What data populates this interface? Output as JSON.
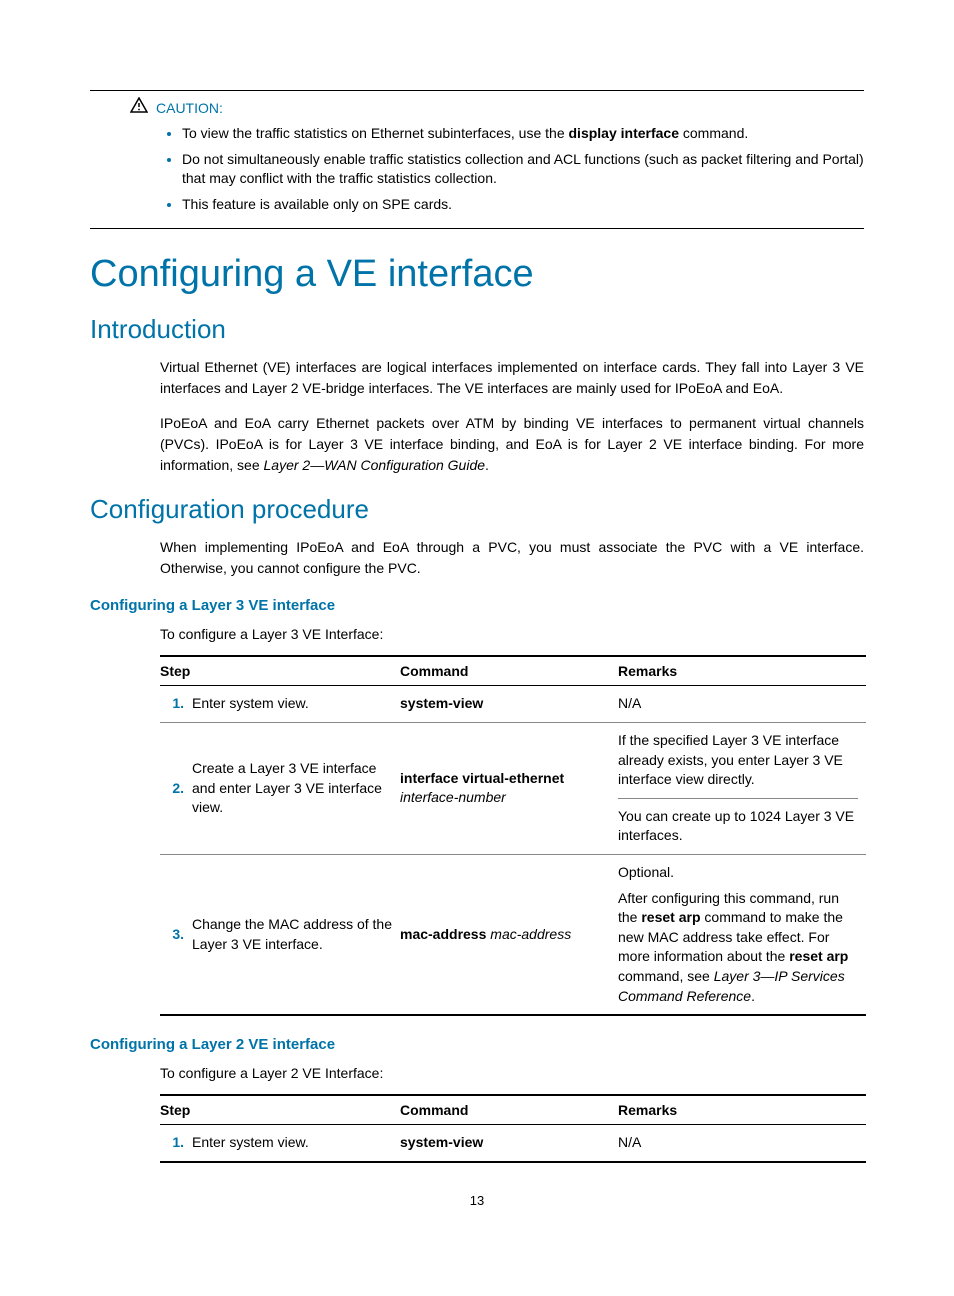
{
  "caution": {
    "label": "CAUTION:",
    "items": [
      {
        "pre": "To view the traffic statistics on Ethernet subinterfaces, use the ",
        "bold": "display interface",
        "post": " command."
      },
      {
        "text": "Do not simultaneously enable traffic statistics collection and ACL functions (such as packet filtering and Portal) that may conflict with the traffic statistics collection."
      },
      {
        "text": "This feature is available only on SPE cards."
      }
    ]
  },
  "h1": "Configuring a VE interface",
  "intro": {
    "heading": "Introduction",
    "p1": "Virtual Ethernet (VE) interfaces are logical interfaces implemented on interface cards. They fall into Layer 3 VE interfaces and Layer 2 VE-bridge interfaces. The VE interfaces are mainly used for IPoEoA and EoA.",
    "p2_pre": "IPoEoA and EoA carry Ethernet packets over ATM by binding VE interfaces to permanent virtual channels (PVCs). IPoEoA is for Layer 3 VE interface binding, and EoA is for Layer 2 VE interface binding. For more information, see ",
    "p2_italic": "Layer 2—WAN Configuration Guide",
    "p2_post": "."
  },
  "config_proc": {
    "heading": "Configuration procedure",
    "p": "When implementing IPoEoA and EoA through a PVC, you must associate the PVC with a VE interface. Otherwise, you cannot configure the PVC."
  },
  "l3": {
    "heading": "Configuring a Layer 3 VE interface",
    "intro": "To configure a Layer 3 VE Interface:",
    "headers": {
      "step": "Step",
      "command": "Command",
      "remarks": "Remarks"
    },
    "rows": [
      {
        "num": "1.",
        "step": "Enter system view.",
        "cmd_bold": "system-view",
        "cmd_italic": "",
        "remarks": "N/A"
      },
      {
        "num": "2.",
        "step": "Create a Layer 3 VE interface and enter Layer 3 VE interface view.",
        "cmd_bold": "interface virtual-ethernet",
        "cmd_italic": "interface-number",
        "remarks_top": "If the specified Layer 3 VE interface already exists, you enter Layer 3 VE interface view directly.",
        "remarks_bottom": "You can create up to 1024 Layer 3 VE interfaces."
      },
      {
        "num": "3.",
        "step": "Change the MAC address of the Layer 3 VE interface.",
        "cmd_bold": "mac-address",
        "cmd_italic": "mac-address",
        "remarks_opt": "Optional.",
        "remarks_pre": "After configuring this command, run the ",
        "remarks_b1": "reset arp",
        "remarks_mid1": " command to make the new MAC address take effect. For more information about the ",
        "remarks_b2": "reset arp",
        "remarks_mid2": " command, see ",
        "remarks_it": "Layer 3—IP Services Command Reference",
        "remarks_post": "."
      }
    ]
  },
  "l2": {
    "heading": "Configuring a Layer 2 VE interface",
    "intro": "To configure a Layer 2 VE Interface:",
    "headers": {
      "step": "Step",
      "command": "Command",
      "remarks": "Remarks"
    },
    "rows": [
      {
        "num": "1.",
        "step": "Enter system view.",
        "cmd_bold": "system-view",
        "cmd_italic": "",
        "remarks": "N/A"
      }
    ]
  },
  "page_number": "13"
}
